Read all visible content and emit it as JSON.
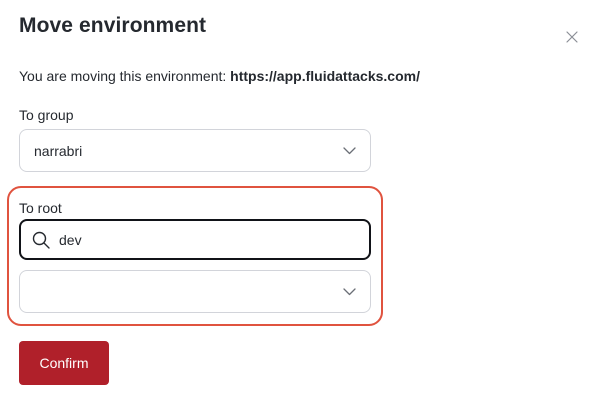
{
  "dialog": {
    "title": "Move environment",
    "subtitle_prefix": "You are moving this environment: ",
    "environment_url": "https://app.fluidattacks.com/"
  },
  "group_field": {
    "label": "To group",
    "selected_value": "narrabri"
  },
  "root_field": {
    "label": "To root",
    "search_value": "dev",
    "selected_value": ""
  },
  "actions": {
    "confirm_label": "Confirm"
  },
  "icons": {
    "close": "close-icon",
    "chevron": "chevron-down-icon",
    "search": "search-icon"
  },
  "colors": {
    "accent": "#b0202a",
    "highlight_border": "#e0533f",
    "text": "#25292f",
    "border": "#d2d4da"
  }
}
